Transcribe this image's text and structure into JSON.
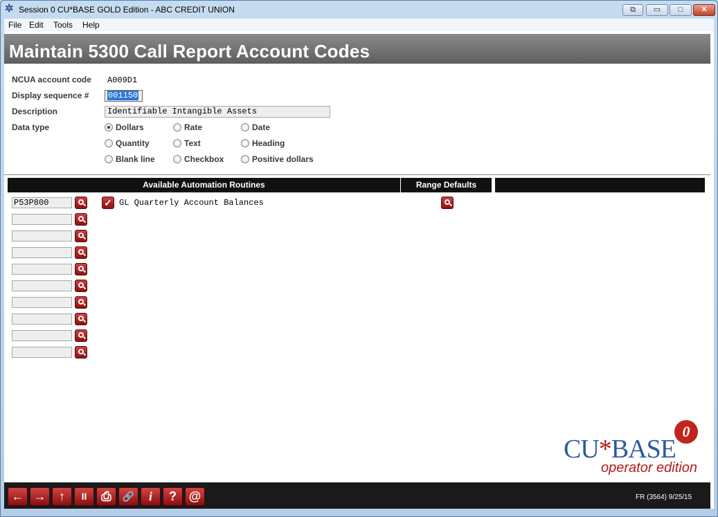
{
  "window": {
    "title": "Session 0 CU*BASE GOLD Edition - ABC CREDIT UNION",
    "icon": "asterisk-app-icon",
    "buttons": {
      "extra": "⧉",
      "minimize": "▭",
      "maximize": "□",
      "close": "✕"
    }
  },
  "menu": [
    "File",
    "Edit",
    "Tools",
    "Help"
  ],
  "page": {
    "title": "Maintain 5300 Call Report Account Codes"
  },
  "form": {
    "ncua_label": "NCUA account code",
    "ncua_value": "A009D1",
    "seq_label": "Display sequence #",
    "seq_value": "001150",
    "desc_label": "Description",
    "desc_value": "Identifiable Intangible Assets",
    "datatype_label": "Data type",
    "datatype_options": [
      "Dollars",
      "Rate",
      "Date",
      "Quantity",
      "Text",
      "Heading",
      "Blank line",
      "Checkbox",
      "Positive dollars"
    ],
    "datatype_selected": "Dollars"
  },
  "table": {
    "headers": {
      "routines": "Available Automation Routines",
      "range": "Range Defaults"
    },
    "codes": [
      "P53P800",
      "",
      "",
      "",
      "",
      "",
      "",
      "",
      "",
      ""
    ],
    "routine_checked": true,
    "routine_label": "GL Quarterly Account Balances"
  },
  "logo": {
    "main_left": "CU",
    "star": "*",
    "main_right": "BASE",
    "sub": "operator edition",
    "gear": "0"
  },
  "footer": {
    "nav_buttons": [
      "←",
      "→",
      "↑",
      "II",
      "⎙",
      "🔗",
      "i",
      "?",
      "@"
    ],
    "status": "FR (3564) 9/25/15"
  },
  "colors": {
    "accent_red": "#b31b1b",
    "header_gray": "#6e6e6e",
    "table_head": "#111111"
  }
}
